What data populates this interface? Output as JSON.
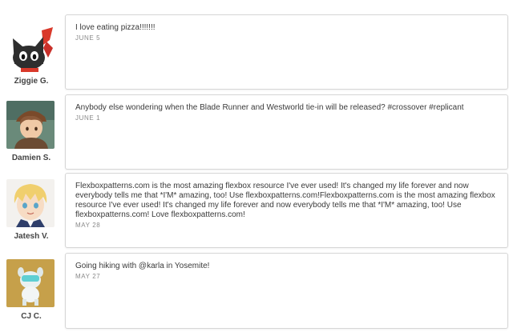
{
  "posts": [
    {
      "author": "Ziggie G.",
      "avatar_icon": "black-cat-avatar-icon",
      "message": "I love eating pizza!!!!!!!",
      "date": "JUNE 5"
    },
    {
      "author": "Damien S.",
      "avatar_icon": "boy-with-cap-avatar-icon",
      "message": "Anybody else wondering when the Blade Runner and Westworld tie-in will be released? #crossover #replicant",
      "date": "JUNE 1"
    },
    {
      "author": "Jatesh V.",
      "avatar_icon": "blonde-anime-avatar-icon",
      "message": "Flexboxpatterns.com is the most amazing flexbox resource I've ever used! It's changed my life forever and now everybody tells me that *I'M* amazing, too! Use flexboxpatterns.com!Flexboxpatterns.com is the most amazing flexbox resource I've ever used! It's changed my life forever and now everybody tells me that *I'M* amazing, too! Use flexboxpatterns.com! Love flexboxpatterns.com!",
      "date": "MAY 28"
    },
    {
      "author": "CJ C.",
      "avatar_icon": "robot-dog-avatar-icon",
      "message": "Going hiking with @karla in Yosemite!",
      "date": "MAY 27"
    }
  ]
}
